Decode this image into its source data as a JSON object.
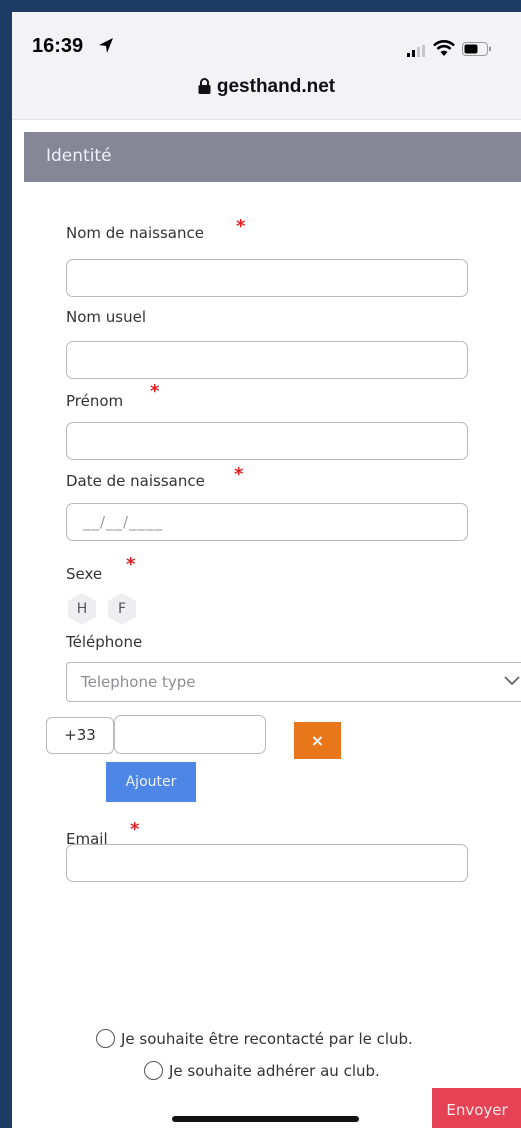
{
  "status_bar": {
    "time": "16:39",
    "url": "gesthand.net"
  },
  "form": {
    "section_title": "Identité",
    "required_mark": "*",
    "fields": {
      "birth_name_label": "Nom de naissance",
      "usual_name_label": "Nom usuel",
      "first_name_label": "Prénom",
      "birth_date_label": "Date de naissance",
      "birth_date_placeholder": "__/__/____",
      "sex_label": "Sexe",
      "sex_options": [
        "H",
        "F"
      ],
      "phone_label": "Téléphone",
      "phone_type_placeholder": "Telephone type",
      "country_code": "+33",
      "remove_phone_label": "×",
      "add_phone_label": "Ajouter",
      "email_label": "Email"
    },
    "options": {
      "contact_label": "Je souhaite être recontacté par le club.",
      "join_label": "Je souhaite adhérer au club."
    },
    "submit_label": "Envoyer"
  },
  "colors": {
    "frame": "#1c3a63",
    "section_header": "#858797",
    "required": "#e02020",
    "remove_button": "#e8771c",
    "add_button": "#4e86e8",
    "submit_button": "#e54256"
  }
}
